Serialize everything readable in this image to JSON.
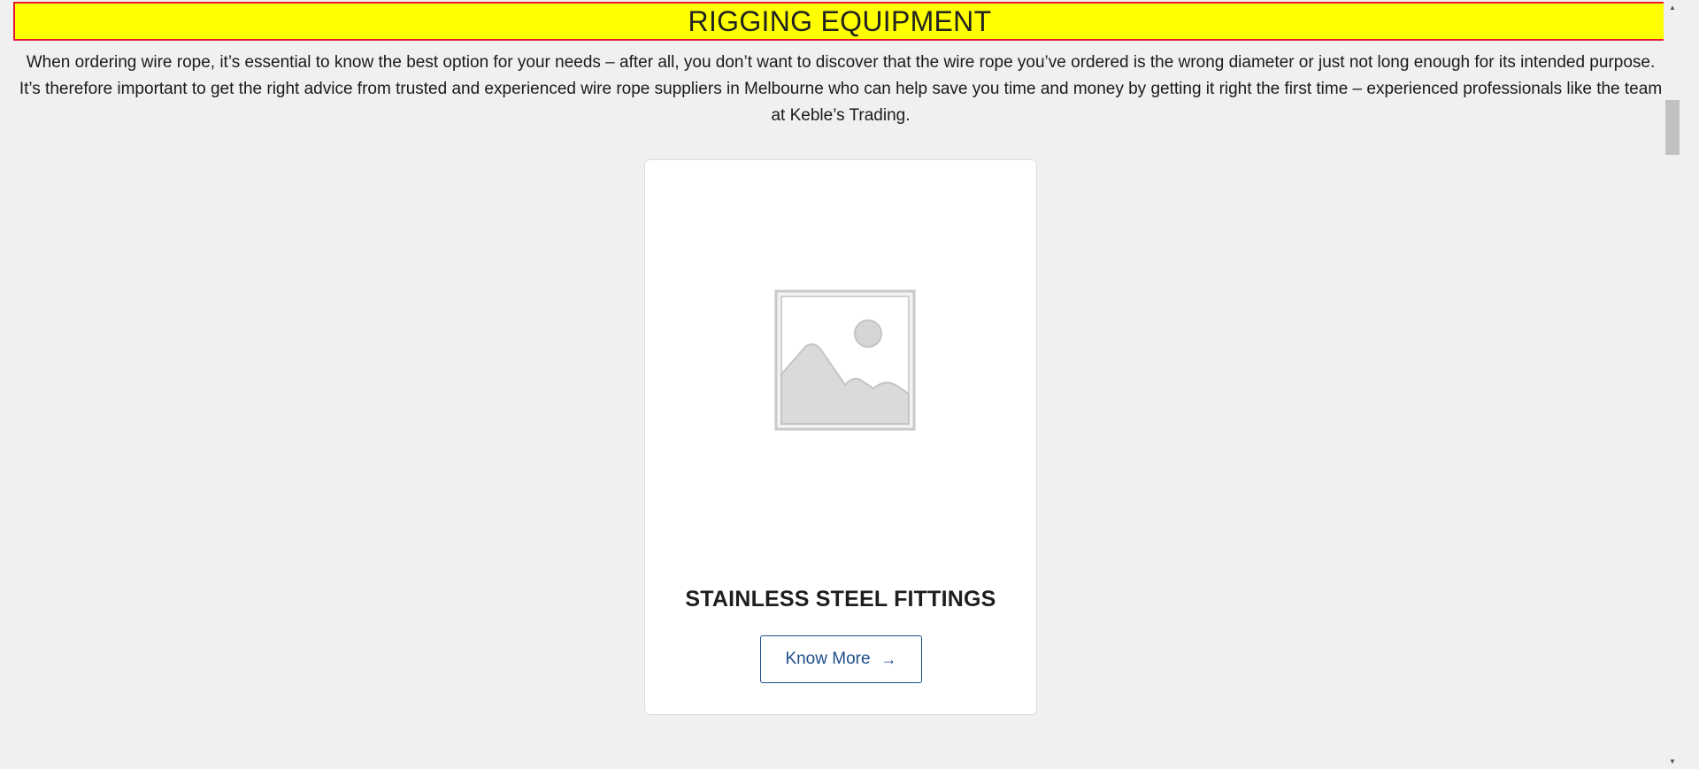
{
  "banner": {
    "title": "RIGGING EQUIPMENT"
  },
  "intro": {
    "text": "When ordering wire rope, it’s essential to know the best option for your needs – after all, you don’t want to discover that the wire rope you’ve ordered is the wrong diameter or just not long enough for its intended purpose. It’s therefore important to get the right advice from trusted and experienced wire rope suppliers in Melbourne who can help save you time and money by getting it right the first time – experienced professionals like the team at Keble’s Trading."
  },
  "product_card": {
    "image_icon": "image-placeholder-icon",
    "title": "STAINLESS STEEL FITTINGS",
    "button_label": "Know More",
    "button_icon": "arrow-right-icon"
  },
  "colors": {
    "banner_bg": "#ffff00",
    "banner_border": "#e5182c",
    "button_accent": "#1d4e89",
    "page_bg": "#f0f0f0"
  }
}
